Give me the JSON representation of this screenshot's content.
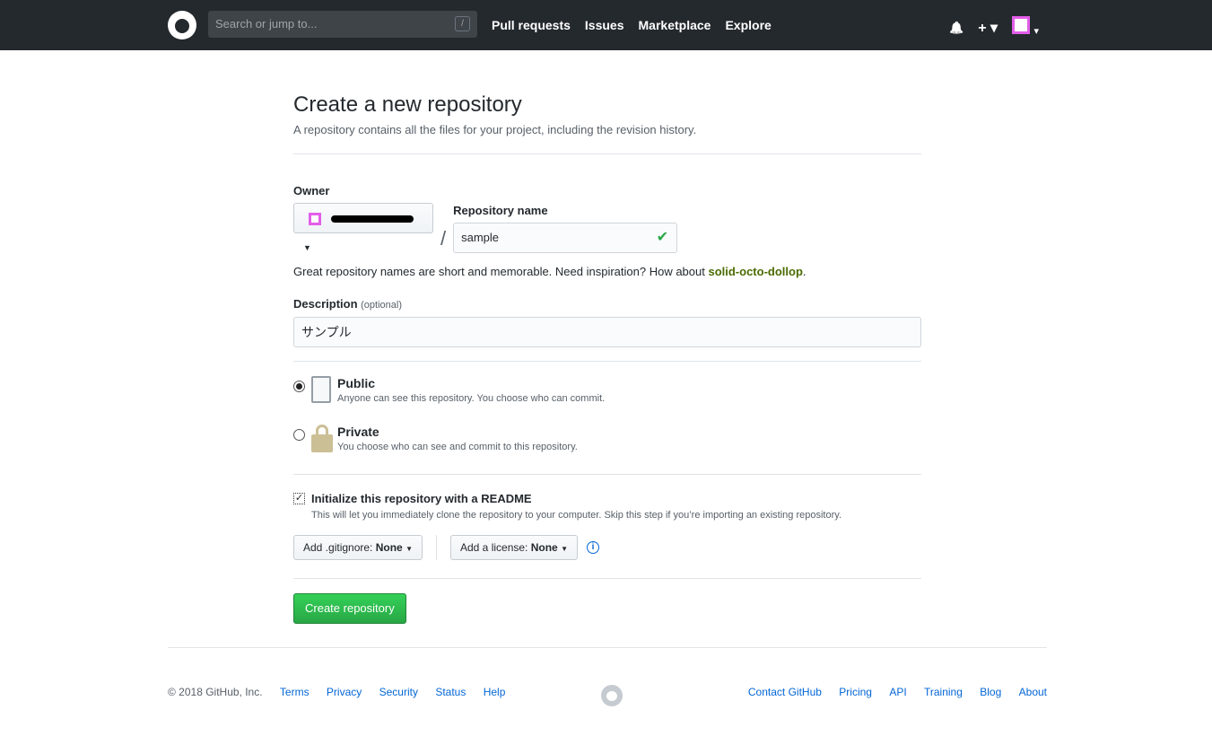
{
  "header": {
    "search_placeholder": "Search or jump to...",
    "slash": "/",
    "nav": [
      "Pull requests",
      "Issues",
      "Marketplace",
      "Explore"
    ],
    "bell": "🔔",
    "plus": "+ ▾",
    "caret": "▾"
  },
  "page": {
    "title": "Create a new repository",
    "subtitle": "A repository contains all the files for your project, including the revision history."
  },
  "form": {
    "owner_label": "Owner",
    "repo_label": "Repository name",
    "repo_value": "sample",
    "check": "✔",
    "slash": "/",
    "hint_prefix": "Great repository names are short and memorable. Need inspiration? How about ",
    "hint_suggestion": "solid-octo-dollop",
    "hint_suffix": ".",
    "description_label": "Description",
    "description_optional": "(optional)",
    "description_value": "サンプル",
    "public_label": "Public",
    "public_desc": "Anyone can see this repository. You choose who can commit.",
    "private_label": "Private",
    "private_desc": "You choose who can see and commit to this repository.",
    "readme_label": "Initialize this repository with a README",
    "readme_desc": "This will let you immediately clone the repository to your computer. Skip this step if you’re importing an existing repository.",
    "gitignore_label": "Add .gitignore:",
    "gitignore_value": "None",
    "license_label": "Add a license:",
    "license_value": "None",
    "info": "i",
    "submit": "Create repository"
  },
  "footer": {
    "copyright": "© 2018 GitHub, Inc.",
    "left_links": [
      "Terms",
      "Privacy",
      "Security",
      "Status",
      "Help"
    ],
    "right_links": [
      "Contact GitHub",
      "Pricing",
      "API",
      "Training",
      "Blog",
      "About"
    ]
  }
}
